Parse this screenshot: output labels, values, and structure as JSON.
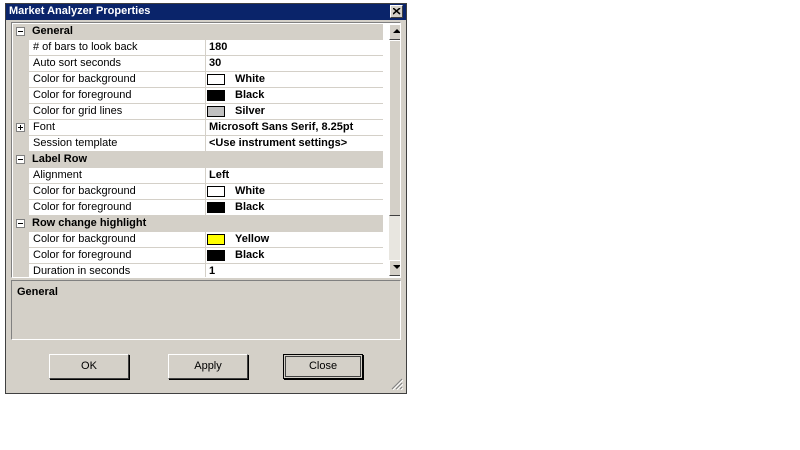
{
  "window": {
    "title": "Market Analyzer Properties"
  },
  "grid": {
    "general": {
      "label": "General",
      "rows": [
        {
          "name": "# of bars to look back",
          "value": "180"
        },
        {
          "name": "Auto sort seconds",
          "value": "30"
        },
        {
          "name": "Color for background",
          "value": "White",
          "color": "#ffffff"
        },
        {
          "name": "Color for foreground",
          "value": "Black",
          "color": "#000000"
        },
        {
          "name": "Color for grid lines",
          "value": "Silver",
          "color": "#c0c0c0"
        },
        {
          "name": "Font",
          "value": "Microsoft Sans Serif, 8.25pt"
        },
        {
          "name": "Session template",
          "value": "<Use instrument settings>"
        }
      ]
    },
    "label_row": {
      "label": "Label Row",
      "rows": [
        {
          "name": "Alignment",
          "value": "Left"
        },
        {
          "name": "Color for background",
          "value": "White",
          "color": "#ffffff"
        },
        {
          "name": "Color for foreground",
          "value": "Black",
          "color": "#000000"
        }
      ]
    },
    "row_change": {
      "label": "Row change highlight",
      "rows": [
        {
          "name": "Color for background",
          "value": "Yellow",
          "color": "#ffff00"
        },
        {
          "name": "Color for foreground",
          "value": "Black",
          "color": "#000000"
        },
        {
          "name": "Duration in seconds",
          "value": "1"
        }
      ]
    }
  },
  "description": {
    "title": "General"
  },
  "buttons": {
    "ok": "OK",
    "apply": "Apply",
    "close": "Close"
  }
}
